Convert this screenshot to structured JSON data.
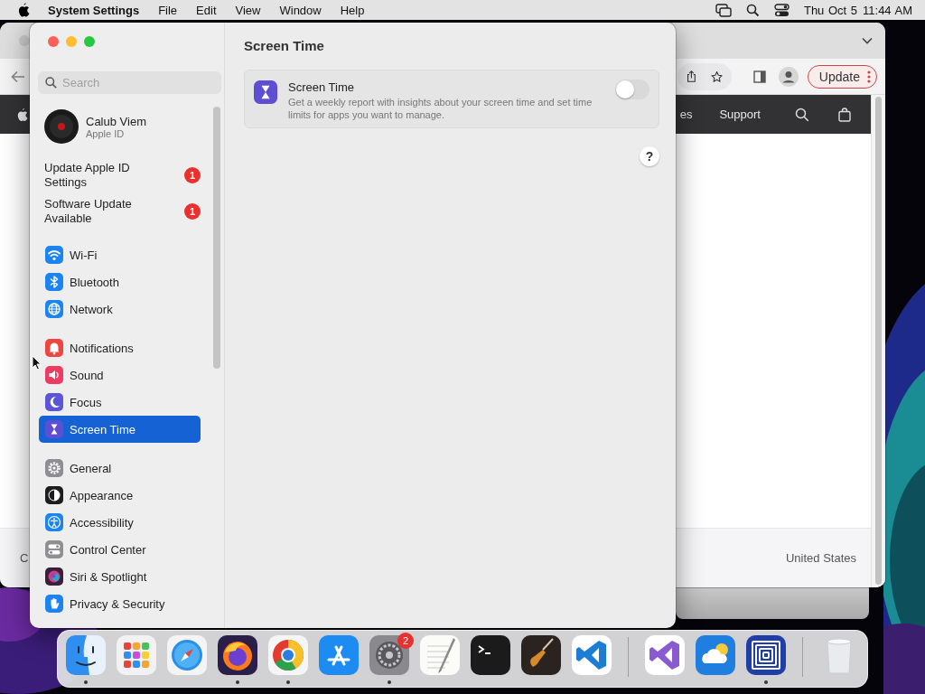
{
  "menubar": {
    "app_name": "System Settings",
    "menus": [
      "File",
      "Edit",
      "View",
      "Window",
      "Help"
    ],
    "date": "Thu Oct 5",
    "time": "11:44 AM"
  },
  "browser": {
    "update_button": "Update",
    "nav_links": [
      "es",
      "Support"
    ],
    "footer_left": "C",
    "footer_region": "United States"
  },
  "settings": {
    "search": {
      "placeholder": "Search"
    },
    "account": {
      "name": "Calub Viem",
      "subtitle": "Apple ID"
    },
    "alerts": [
      {
        "label": "Update Apple ID Settings",
        "badge": "1"
      },
      {
        "label": "Software Update Available",
        "badge": "1"
      }
    ],
    "groups": [
      {
        "items": [
          {
            "label": "Wi-Fi",
            "selected": false
          },
          {
            "label": "Bluetooth",
            "selected": false
          },
          {
            "label": "Network",
            "selected": false
          }
        ]
      },
      {
        "items": [
          {
            "label": "Notifications",
            "selected": false
          },
          {
            "label": "Sound",
            "selected": false
          },
          {
            "label": "Focus",
            "selected": false
          },
          {
            "label": "Screen Time",
            "selected": true
          }
        ]
      },
      {
        "items": [
          {
            "label": "General",
            "selected": false
          },
          {
            "label": "Appearance",
            "selected": false
          },
          {
            "label": "Accessibility",
            "selected": false
          },
          {
            "label": "Control Center",
            "selected": false
          },
          {
            "label": "Siri & Spotlight",
            "selected": false
          },
          {
            "label": "Privacy & Security",
            "selected": false
          }
        ]
      }
    ],
    "page_title": "Screen Time",
    "card": {
      "title": "Screen Time",
      "description": "Get a weekly report with insights about your screen time and set time limits for apps you want to manage.",
      "on": false
    },
    "help_button": "?"
  },
  "dock": {
    "apps": [
      {
        "running": true
      },
      {
        "running": false
      },
      {
        "running": false
      },
      {
        "running": true
      },
      {
        "running": true
      },
      {
        "running": false
      },
      {
        "running": true,
        "badge": "2"
      },
      {
        "running": false
      },
      {
        "running": false
      },
      {
        "running": false
      },
      {
        "running": false
      },
      {
        "running": false
      },
      {
        "running": false
      },
      {
        "running": true
      },
      {
        "running": false
      }
    ]
  }
}
